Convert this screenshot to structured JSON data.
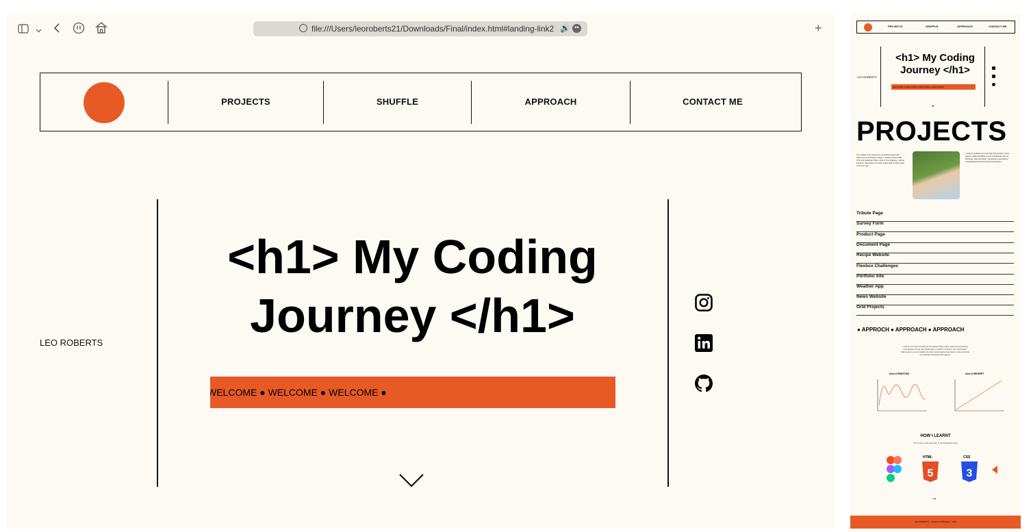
{
  "browser": {
    "url": "file:///Users/leoroberts21/Downloads/Final/index.html#landing-link2",
    "new_tab_label": "+"
  },
  "site": {
    "nav_links": [
      "PROJECTS",
      "SHUFFLE",
      "APPROACH",
      "CONTACT ME"
    ],
    "name": "LEO ROBERTS",
    "headline_line1": "<h1> My Coding",
    "headline_line2": "Journey </h1>",
    "marquee": "WELCOME ● WELCOME ● WELCOME ●",
    "social_icons": [
      "instagram-icon",
      "linkedin-icon",
      "github-icon"
    ],
    "accent_color": "#e85a25",
    "background_color": "#fdfaf3"
  },
  "preview": {
    "nav_links": [
      "PROJECTS",
      "SHUFFLE",
      "APPROACH",
      "CONTACT ME"
    ],
    "name": "LEO ROBERTS",
    "headline": "<h1> My Coding Journey </h1>",
    "marquee": "WELCOME ● WELCOME ● WELCOME ● WELCOME ●",
    "projects_heading": "PROJECTS",
    "intro_left": "This website is the result of an overarching project that documents my learning of coding. I wanted to learn HTML, CSS, and JavaScript. When I took on this challenge, I had an interest in web design, but I had no idea what to expect when it came to code.",
    "intro_right": "I ended up building a lot more than first intended. I have gained a solid knowledge on front end libraries such as Bootstrap, Sass and React. I developed a great deal of knowledge and felt the growth as a developer.",
    "projects": [
      "Tribute Page",
      "Survey Form",
      "Product Page",
      "Document Page",
      "Recipe Website",
      "Flexbox Challenges",
      "Portfolio Site",
      "Weather App",
      "News Website",
      "Grid Projects"
    ],
    "approach_heading": "● APPROCH ● APPROACH ● APPROACH",
    "approach_text": "I had a lot of ups and downs throughout this project, learning something new always brings new challenges in which I enjoyed. The information below gives you an insight into how I approached learning to code and how my feelings developed throughout.",
    "graph1_title": "Axis of EMOTION",
    "graph2_title": "Axis of REGRET",
    "howilearnt": "HOW I LEARNT",
    "howilearnt_sub": "This is how I was learning, in chronological order.",
    "tool_labels": [
      "HTML",
      "CSS"
    ],
    "arrow": "→",
    "footer": "LEO ROBERTS - Graduate Publication - 2022"
  }
}
